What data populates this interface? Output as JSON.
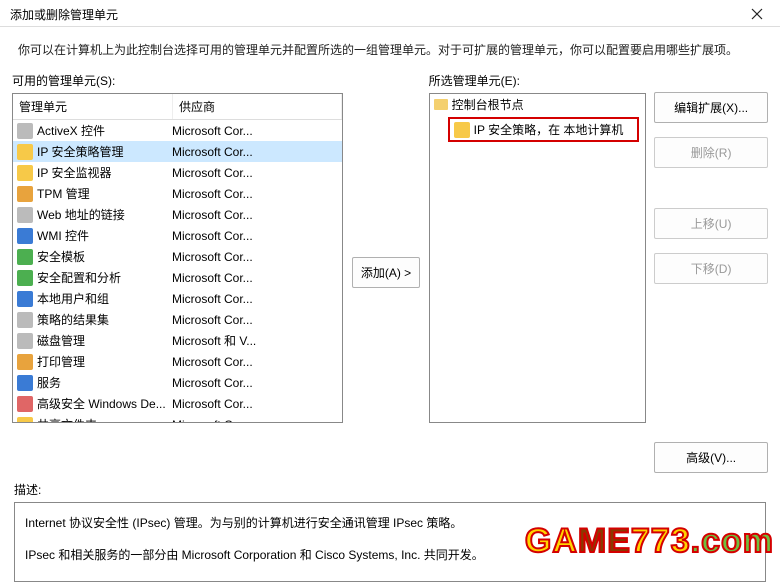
{
  "window": {
    "title": "添加或删除管理单元",
    "intro": "你可以在计算机上为此控制台选择可用的管理单元并配置所选的一组管理单元。对于可扩展的管理单元，你可以配置要启用哪些扩展项。"
  },
  "labels": {
    "available": "可用的管理单元(S):",
    "selected": "所选管理单元(E):",
    "col_snapin": "管理单元",
    "col_vendor": "供应商",
    "add_btn": "添加(A) >",
    "edit_ext": "编辑扩展(X)...",
    "remove": "删除(R)",
    "move_up": "上移(U)",
    "move_down": "下移(D)",
    "advanced": "高级(V)...",
    "desc_label": "描述:"
  },
  "available_items": [
    {
      "name": "ActiveX 控件",
      "vendor": "Microsoft Cor...",
      "icon": "ic-gray"
    },
    {
      "name": "IP 安全策略管理",
      "vendor": "Microsoft Cor...",
      "icon": "ic-yellow",
      "selected": true
    },
    {
      "name": "IP 安全监视器",
      "vendor": "Microsoft Cor...",
      "icon": "ic-yellow"
    },
    {
      "name": "TPM 管理",
      "vendor": "Microsoft Cor...",
      "icon": "ic-orange"
    },
    {
      "name": "Web 地址的链接",
      "vendor": "Microsoft Cor...",
      "icon": "ic-gray"
    },
    {
      "name": "WMI 控件",
      "vendor": "Microsoft Cor...",
      "icon": "ic-blue"
    },
    {
      "name": "安全模板",
      "vendor": "Microsoft Cor...",
      "icon": "ic-green"
    },
    {
      "name": "安全配置和分析",
      "vendor": "Microsoft Cor...",
      "icon": "ic-green"
    },
    {
      "name": "本地用户和组",
      "vendor": "Microsoft Cor...",
      "icon": "ic-blue"
    },
    {
      "name": "策略的结果集",
      "vendor": "Microsoft Cor...",
      "icon": "ic-gray"
    },
    {
      "name": "磁盘管理",
      "vendor": "Microsoft 和 V...",
      "icon": "ic-gray"
    },
    {
      "name": "打印管理",
      "vendor": "Microsoft Cor...",
      "icon": "ic-orange"
    },
    {
      "name": "服务",
      "vendor": "Microsoft Cor...",
      "icon": "ic-blue"
    },
    {
      "name": "高级安全 Windows De...",
      "vendor": "Microsoft Cor...",
      "icon": "ic-red"
    },
    {
      "name": "共享文件夹",
      "vendor": "Microsoft Cor...",
      "icon": "ic-yellow"
    }
  ],
  "tree": {
    "root": "控制台根节点",
    "item": "IP 安全策略，在 本地计算机"
  },
  "description": {
    "line1": "Internet 协议安全性 (IPsec) 管理。为与别的计算机进行安全通讯管理 IPsec 策略。",
    "line2": "IPsec 和相关服务的一部分由 Microsoft Corporation 和 Cisco Systems, Inc. 共同开发。"
  },
  "watermark": "GAME773.com"
}
